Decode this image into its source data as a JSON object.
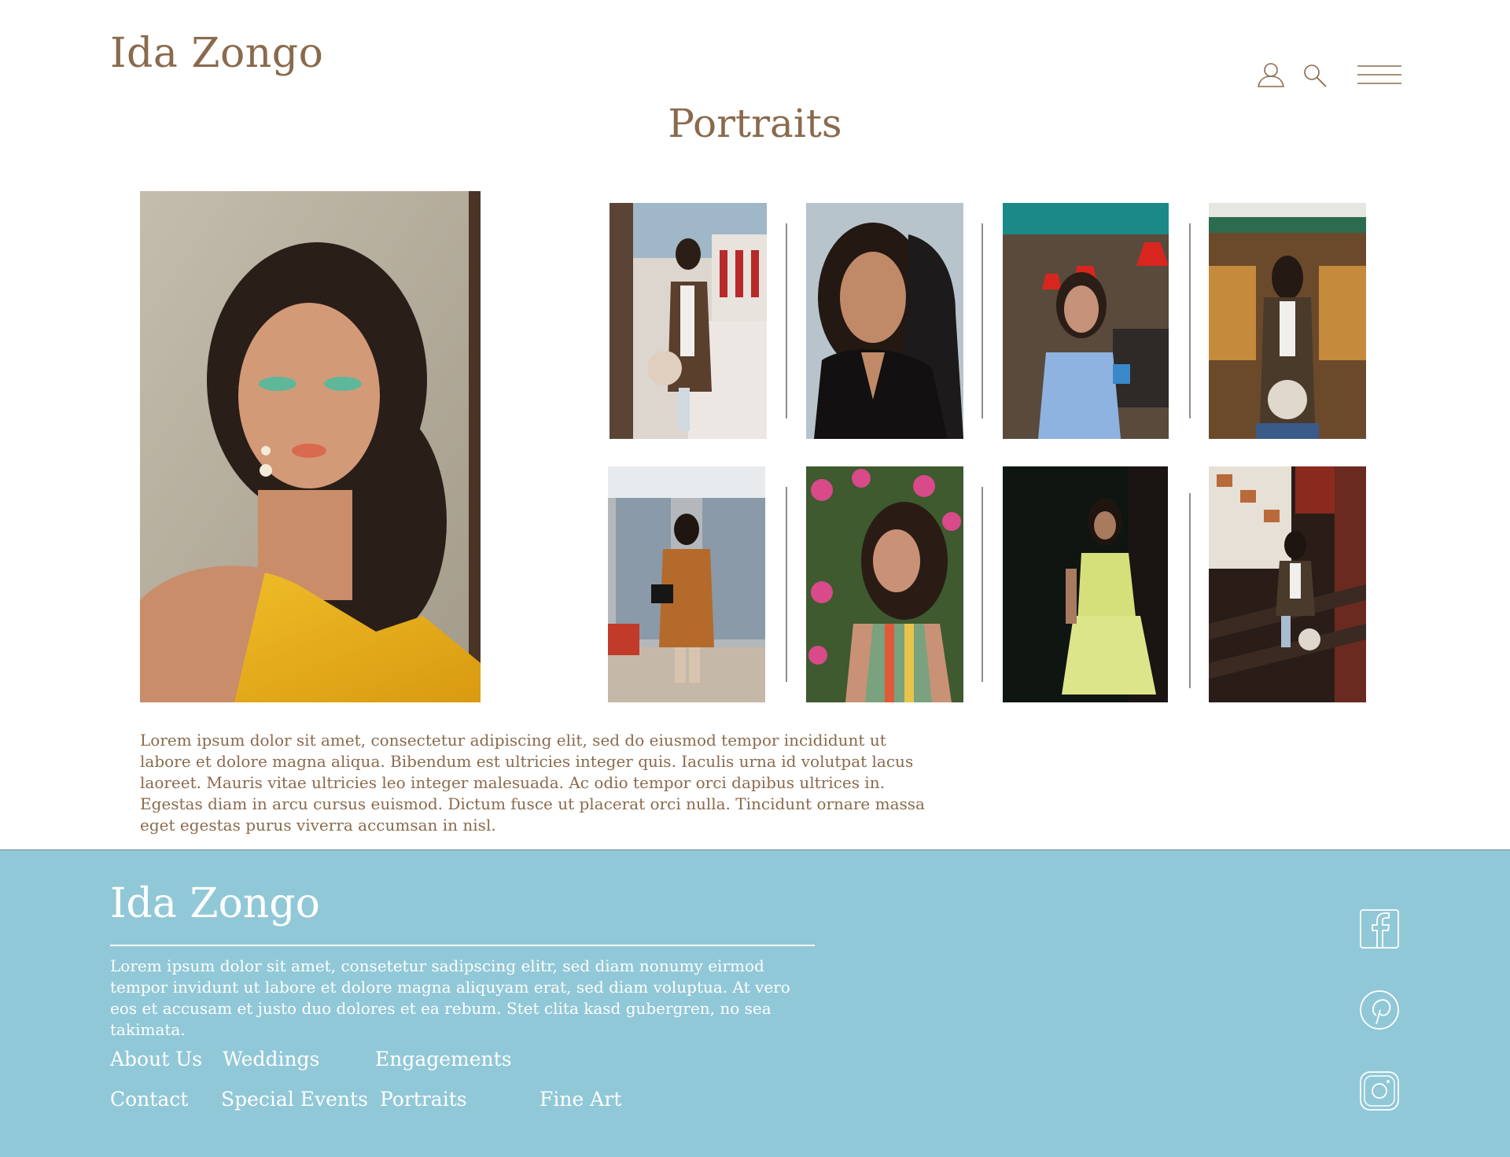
{
  "header": {
    "brand": "Ida Zongo",
    "icons": [
      "user-icon",
      "search-icon",
      "menu-icon"
    ]
  },
  "page_title": "Portraits",
  "gallery": {
    "featured": "featured-portrait",
    "thumbnails": [
      "portrait-brown-coat-window",
      "portrait-black-top",
      "portrait-blue-dress-diner",
      "portrait-market-awning",
      "portrait-mall-escalator",
      "portrait-roses",
      "portrait-yellow-dress-dark",
      "portrait-stairs"
    ]
  },
  "intro_text": " Lorem ipsum dolor sit amet, consectetur adipiscing elit, sed do eiusmod tempor incididunt ut labore et dolore magna aliqua. Bibendum est ultricies integer quis. Iaculis urna id volutpat lacus laoreet. Mauris vitae ultricies leo integer malesuada. Ac odio tempor orci dapibus ultrices in. Egestas diam in arcu cursus euismod. Dictum fusce ut placerat orci nulla. Tincidunt ornare massa eget egestas purus viverra accumsan in nisl.",
  "footer": {
    "brand": "Ida Zongo",
    "text": "Lorem ipsum dolor sit amet, consetetur sadipscing elitr, sed diam nonumy eirmod tempor invidunt ut labore et dolore magna aliquyam erat, sed diam voluptua. At vero eos et accusam et justo duo dolores et ea rebum. Stet clita kasd gubergren, no sea takimata.",
    "links": {
      "about": "About Us",
      "weddings": "Weddings",
      "engagements": "Engagements",
      "contact": "Contact",
      "special_events": "Special Events",
      "portraits": "Portraits",
      "fine_art": "Fine Art"
    },
    "social_icons": [
      "facebook-icon",
      "pinterest-icon",
      "instagram-icon"
    ]
  },
  "colors": {
    "brand_brown": "#8a6a4c",
    "footer_blue": "#91c8d7",
    "white": "#ffffff"
  }
}
